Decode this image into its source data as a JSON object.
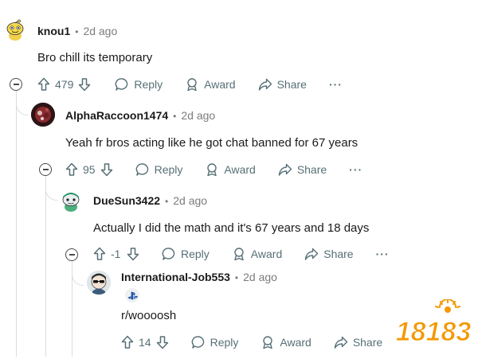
{
  "comments": [
    {
      "username": "knou1",
      "separator": "•",
      "time": "2d ago",
      "body": "Bro chill its temporary",
      "score": "479",
      "reply_label": "Reply",
      "award_label": "Award",
      "share_label": "Share",
      "more": "···",
      "avatar_icon": "snoo-avatar-yellow-icon"
    },
    {
      "username": "AlphaRaccoon1474",
      "separator": "•",
      "time": "2d ago",
      "body": "Yeah fr bros acting like he got chat banned for 67 years",
      "score": "95",
      "reply_label": "Reply",
      "award_label": "Award",
      "share_label": "Share",
      "more": "···",
      "avatar_icon": "dark-red-avatar-icon"
    },
    {
      "username": "DueSun3422",
      "separator": "•",
      "time": "2d ago",
      "body": "Actually I did the math and it's 67 years and 18 days",
      "score": "-1",
      "reply_label": "Reply",
      "award_label": "Award",
      "share_label": "Share",
      "more": "···",
      "avatar_icon": "snoo-avatar-green-icon"
    },
    {
      "username": "International-Job553",
      "separator": "•",
      "time": "2d ago",
      "body": "r/woooosh",
      "score": "14",
      "reply_label": "Reply",
      "award_label": "Award",
      "share_label": "Share",
      "more": "···",
      "avatar_icon": "sunglasses-avatar-icon",
      "flair_icon": "playstation-icon"
    }
  ],
  "watermark": {
    "text": "18183",
    "icon": "site-logo-icon"
  },
  "colors": {
    "text": "#1a1a1b",
    "muted": "#576f76",
    "thread_line": "#dadde0",
    "link": "#1a1a1b",
    "watermark_orange": "#f39800"
  }
}
